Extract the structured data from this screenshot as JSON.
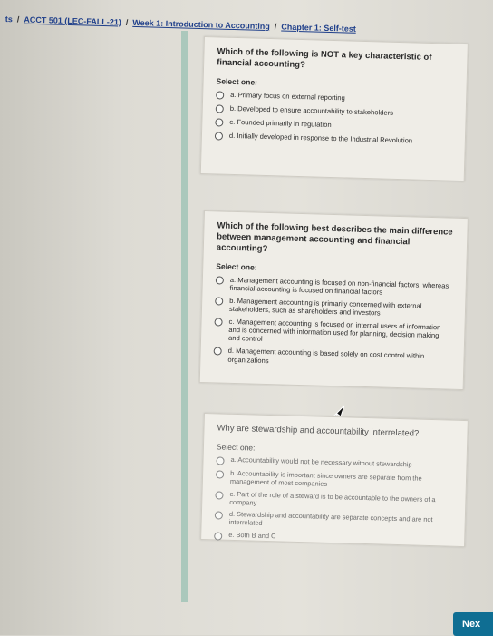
{
  "breadcrumb": {
    "items": [
      "ts",
      "ACCT 501 (LEC-FALL-21)",
      "Week 1: Introduction to Accounting",
      "Chapter 1: Self-test"
    ],
    "separator": "/"
  },
  "questions": [
    {
      "text": "Which of the following is NOT a key characteristic of financial accounting?",
      "select_label": "Select one:",
      "options": [
        "a. Primary focus on external reporting",
        "b. Developed to ensure accountability to stakeholders",
        "c. Founded primarily in regulation",
        "d. Initially developed in response to the Industrial Revolution"
      ]
    },
    {
      "text": "Which of the following best describes the main difference between management accounting and financial accounting?",
      "select_label": "Select one:",
      "options": [
        "a. Management accounting is focused on non-financial factors, whereas financial accounting is focused on financial factors",
        "b. Management accounting is primarily concerned with external stakeholders, such as shareholders and investors",
        "c. Management accounting is focused on internal users of information and is concerned with information used for planning, decision making, and control",
        "d. Management accounting is based solely on cost control within organizations"
      ]
    },
    {
      "text": "Why are stewardship and accountability interrelated?",
      "select_label": "Select one:",
      "options": [
        "a. Accountability would not be necessary without stewardship",
        "b. Accountability is important since owners are separate from the management of most companies",
        "c. Part of the role of a steward is to be accountable to the owners of a company",
        "d. Stewardship and accountability are separate concepts and are not interrelated",
        "e. Both B and C"
      ]
    }
  ],
  "next_button": {
    "label": "Nex"
  },
  "icons": {
    "cursor": "mouse-pointer-icon",
    "option": "radio-icon"
  },
  "colors": {
    "link": "#1f3f8a",
    "button": "#0f6e93"
  }
}
